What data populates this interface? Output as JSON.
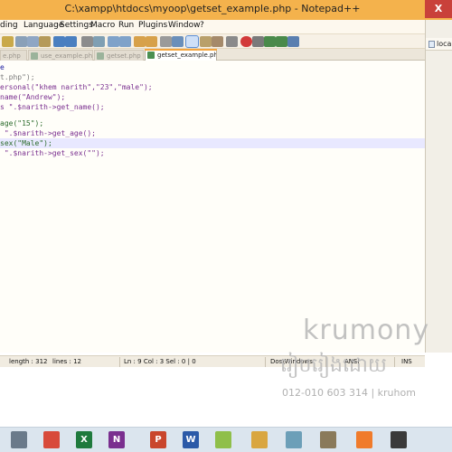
{
  "window": {
    "title": "C:\\xampp\\htdocs\\myoop\\getset_example.php - Notepad++",
    "close_glyph": "X"
  },
  "menu": {
    "items": [
      "ding",
      "Language",
      "Settings",
      "Macro",
      "Run",
      "Plugins",
      "Window",
      "?"
    ]
  },
  "tabs": [
    {
      "label": "e.php",
      "active": false
    },
    {
      "label": "use_example.php",
      "active": false
    },
    {
      "label": "getset.php",
      "active": false
    },
    {
      "label": "getset_example.php",
      "active": true
    }
  ],
  "editor": {
    "lines": [
      {
        "text": "e",
        "current": false
      },
      {
        "text": "t.php\");",
        "current": false
      },
      {
        "text": "ersonal(\"khem narith\",\"23\",\"male\");",
        "current": false
      },
      {
        "text": "name(\"Andrew\");",
        "current": false
      },
      {
        "text": "s \".$narith->get_name();",
        "current": false
      },
      {
        "text": "",
        "current": false
      },
      {
        "text": "age(\"15\");",
        "current": false
      },
      {
        "text": " \".$narith->get_age();",
        "current": false
      },
      {
        "text": "sex(\"Male\");",
        "current": true
      },
      {
        "text": " \".$narith->get_sex(\"\");",
        "current": false
      }
    ]
  },
  "right_panel": {
    "label": "loca"
  },
  "status": {
    "length": "length : 312",
    "lines": "lines : 12",
    "position": "Ln : 9    Col : 3    Sel : 0 | 0",
    "eol": "Dos\\Windows",
    "encoding": "ANSI",
    "mode": "INS"
  },
  "watermark": {
    "brand": "krumony",
    "khmer": "រៀបរៀងដោយ",
    "contact": "012-010 603 314 | kruhom"
  },
  "taskbar": {
    "icons": [
      {
        "name": "browser-icon",
        "color": "#6a7a8a",
        "glyph": ""
      },
      {
        "name": "chrome-icon",
        "color": "#d84a3a",
        "glyph": ""
      },
      {
        "name": "excel-icon",
        "color": "#1f7a3d",
        "glyph": "X"
      },
      {
        "name": "onenote-icon",
        "color": "#7a2f8f",
        "glyph": "N"
      },
      {
        "name": "powerpoint-icon",
        "color": "#c9462c",
        "glyph": "P"
      },
      {
        "name": "word-icon",
        "color": "#2b5aa8",
        "glyph": "W"
      },
      {
        "name": "notepadpp-icon",
        "color": "#8fbf4a",
        "glyph": ""
      },
      {
        "name": "file-manager-icon",
        "color": "#d9a640",
        "glyph": ""
      },
      {
        "name": "notes-icon",
        "color": "#6c9fb8",
        "glyph": ""
      },
      {
        "name": "tools-icon",
        "color": "#8a7a5a",
        "glyph": ""
      },
      {
        "name": "xampp-icon",
        "color": "#f07b2b",
        "glyph": ""
      },
      {
        "name": "video-icon",
        "color": "#3a3a3a",
        "glyph": ""
      }
    ]
  }
}
